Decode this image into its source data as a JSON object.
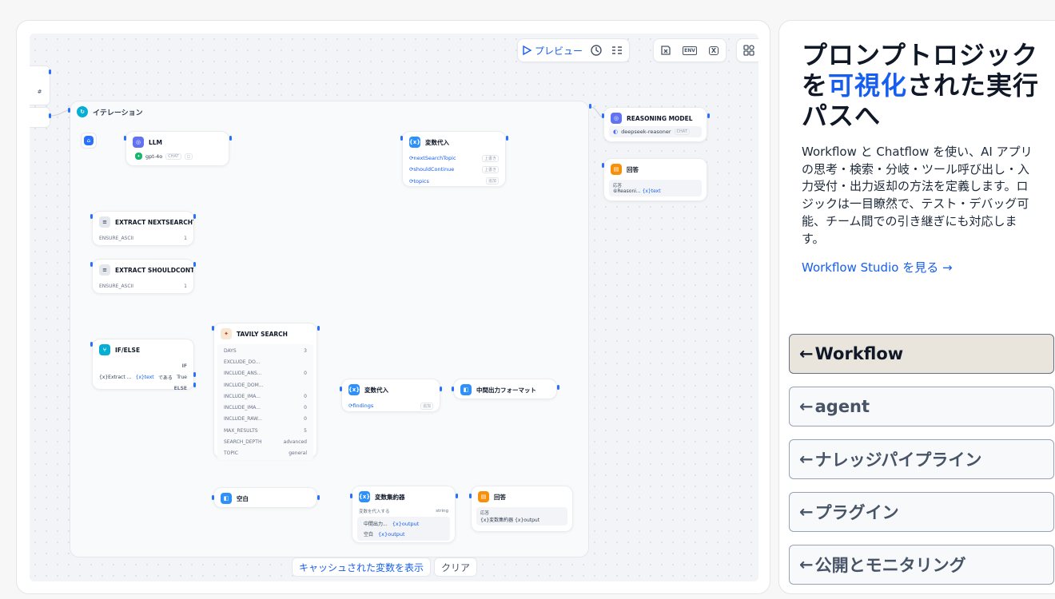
{
  "toolbar": {
    "preview_label": "プレビュー",
    "icons": [
      "history-icon",
      "checklist-icon",
      "variable-inspect-icon",
      "env-icon",
      "conversation-var-icon",
      "features-icon"
    ],
    "env_text": "ENV",
    "x_text": "X"
  },
  "canvas": {
    "side_tab_text": "#",
    "iteration_title": "イテレーション",
    "nodes": {
      "llm": {
        "title": "LLM",
        "model": "gpt-4o",
        "tag": "CHAT"
      },
      "assign_top": {
        "title": "変数代入",
        "rows": [
          {
            "name": "nextSearchTopic",
            "op": "上書き"
          },
          {
            "name": "shouldContinue",
            "op": "上書き"
          },
          {
            "name": "topics",
            "op": "追加"
          }
        ]
      },
      "extract1": {
        "title": "EXTRACT NEXTSEARCHT...",
        "param": "ENSURE_ASCII",
        "value": "1"
      },
      "extract2": {
        "title": "EXTRACT SHOULDCONTI...",
        "param": "ENSURE_ASCII",
        "value": "1"
      },
      "ifelse": {
        "title": "IF/ELSE",
        "if_label": "IF",
        "cond_left": "{x}Extract ...",
        "cond_var": "{x}text",
        "cond_op": "である",
        "cond_val": "True",
        "else_label": "ELSE"
      },
      "tavily": {
        "title": "TAVILY SEARCH",
        "rows": [
          {
            "k": "DAYS",
            "v": "3"
          },
          {
            "k": "EXCLUDE_DO...",
            "v": ""
          },
          {
            "k": "INCLUDE_ANS...",
            "v": "0"
          },
          {
            "k": "INCLUDE_DOM...",
            "v": ""
          },
          {
            "k": "INCLUDE_IMA...",
            "v": "0"
          },
          {
            "k": "INCLUDE_IMA...",
            "v": "0"
          },
          {
            "k": "INCLUDE_RAW...",
            "v": "0"
          },
          {
            "k": "MAX_RESULTS",
            "v": "5"
          },
          {
            "k": "SEARCH_DEPTH",
            "v": "advanced"
          },
          {
            "k": "TOPIC",
            "v": "general"
          }
        ]
      },
      "assign_mid": {
        "title": "変数代入",
        "row_name": "findings",
        "row_op": "追加"
      },
      "format_mid": {
        "title": "中間出力フォーマット"
      },
      "blank": {
        "title": "空白"
      },
      "aggregator": {
        "title": "変数集約器",
        "sub_label": "変数を代入する",
        "sub_type": "string",
        "rows": [
          "中間出力...",
          "空白"
        ],
        "var": "{x}output"
      },
      "answer_inner": {
        "title": "回答",
        "label": "応答",
        "value": "{x}変数集約器 {x}output"
      },
      "reasoning": {
        "title": "REASONING MODEL",
        "model": "deepseek-reasoner",
        "tag": "CHAT"
      },
      "answer_outer": {
        "title": "回答",
        "label": "応答",
        "value": "⑥Reasoni...",
        "var": "{x}text"
      }
    }
  },
  "bottom_bar": {
    "show_cache": "キャッシュされた変数を表示",
    "clear": "クリア"
  },
  "panel": {
    "heading_before": "プロンプトロジックを",
    "heading_highlight": "可視化",
    "heading_after": "された実行パスへ",
    "description": "Workflow と Chatflow を使い、AI アプリの思考・検索・分岐・ツール呼び出し・入力受付・出力返却の方法を定義します。ロジックは一目瞭然で、テスト・デバッグ可能、チーム間での引き継ぎにも対応します。",
    "link": "Workflow Studio を見る →",
    "nav": [
      {
        "label": "Workflow",
        "active": true
      },
      {
        "label": "agent",
        "active": false
      },
      {
        "label": "ナレッジパイプライン",
        "active": false
      },
      {
        "label": "プラグイン",
        "active": false
      },
      {
        "label": "公開とモニタリング",
        "active": false
      }
    ],
    "arrow": "←"
  },
  "colors": {
    "accent": "#155eef",
    "active_nav_bg": "#e9e4dc"
  }
}
